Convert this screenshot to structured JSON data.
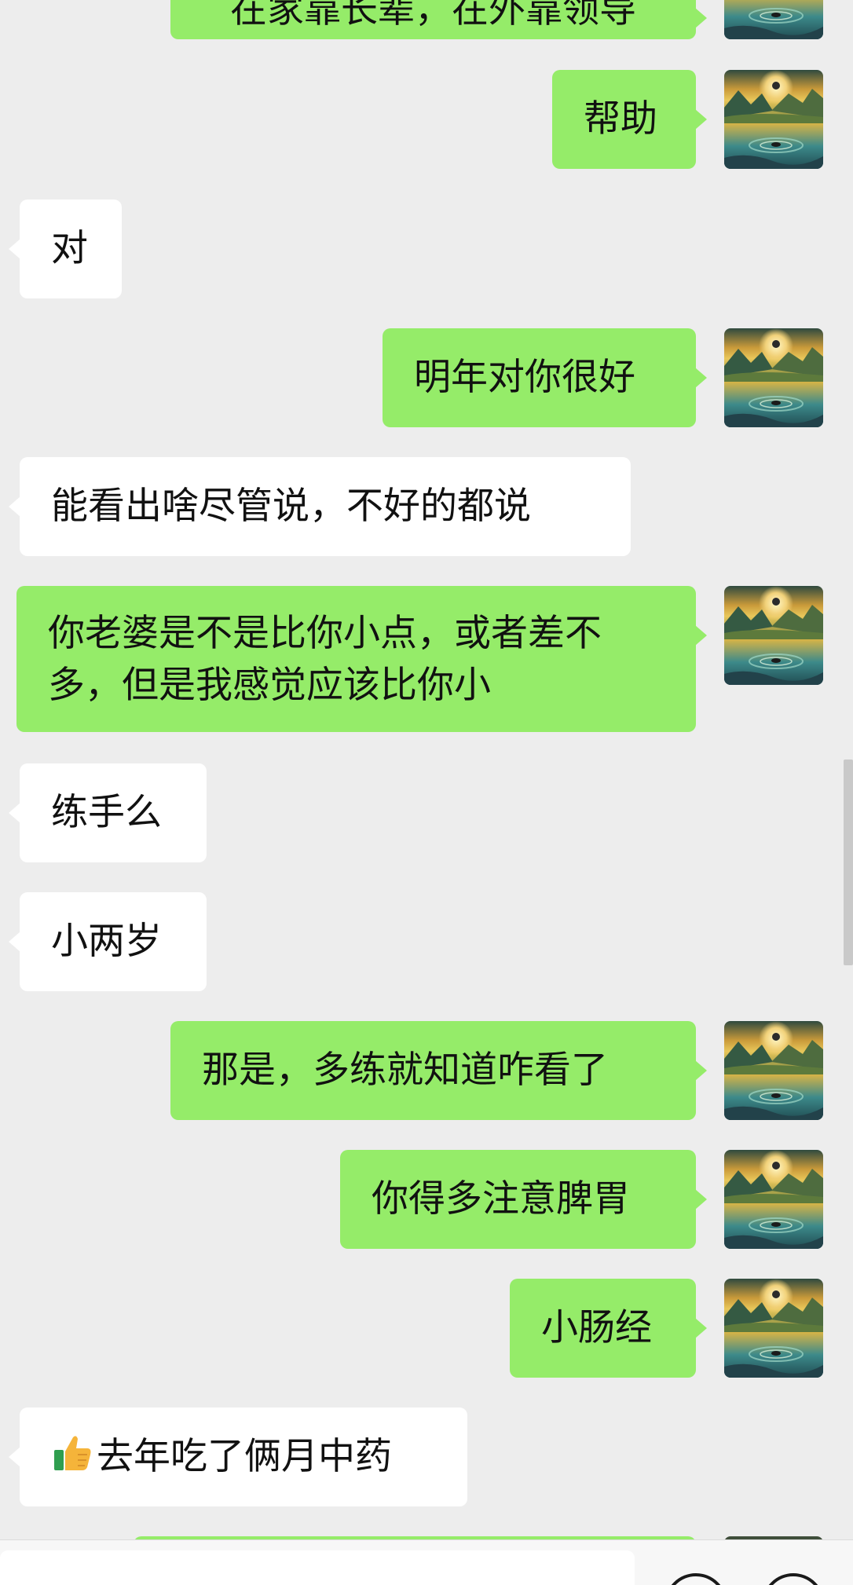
{
  "app": "chat",
  "colors": {
    "background": "#ededed",
    "sent_bubble": "#95ec69",
    "received_bubble": "#ffffff"
  },
  "avatar_icon": "landscape-avatar-icon",
  "thumbs_icon": "thumbs-up-icon",
  "messages": [
    {
      "direction": "sent",
      "text": "在家靠长辈，在外靠领导"
    },
    {
      "direction": "sent",
      "text": "帮助"
    },
    {
      "direction": "received",
      "text": "对"
    },
    {
      "direction": "sent",
      "text": "明年对你很好"
    },
    {
      "direction": "received",
      "text": "能看出啥尽管说，不好的都说"
    },
    {
      "direction": "sent",
      "line1": "你老婆是不是比你小点，或者差不",
      "line2": "多，但是我感觉应该比你小"
    },
    {
      "direction": "received",
      "text": "练手么"
    },
    {
      "direction": "received",
      "text": "小两岁"
    },
    {
      "direction": "sent",
      "text": "那是，多练就知道咋看了"
    },
    {
      "direction": "sent",
      "text": "你得多注意脾胃"
    },
    {
      "direction": "sent",
      "text": "小肠经"
    },
    {
      "direction": "received",
      "text": "去年吃了俩月中药",
      "emoji": "thumbs-up"
    }
  ],
  "input": {
    "placeholder": ""
  }
}
